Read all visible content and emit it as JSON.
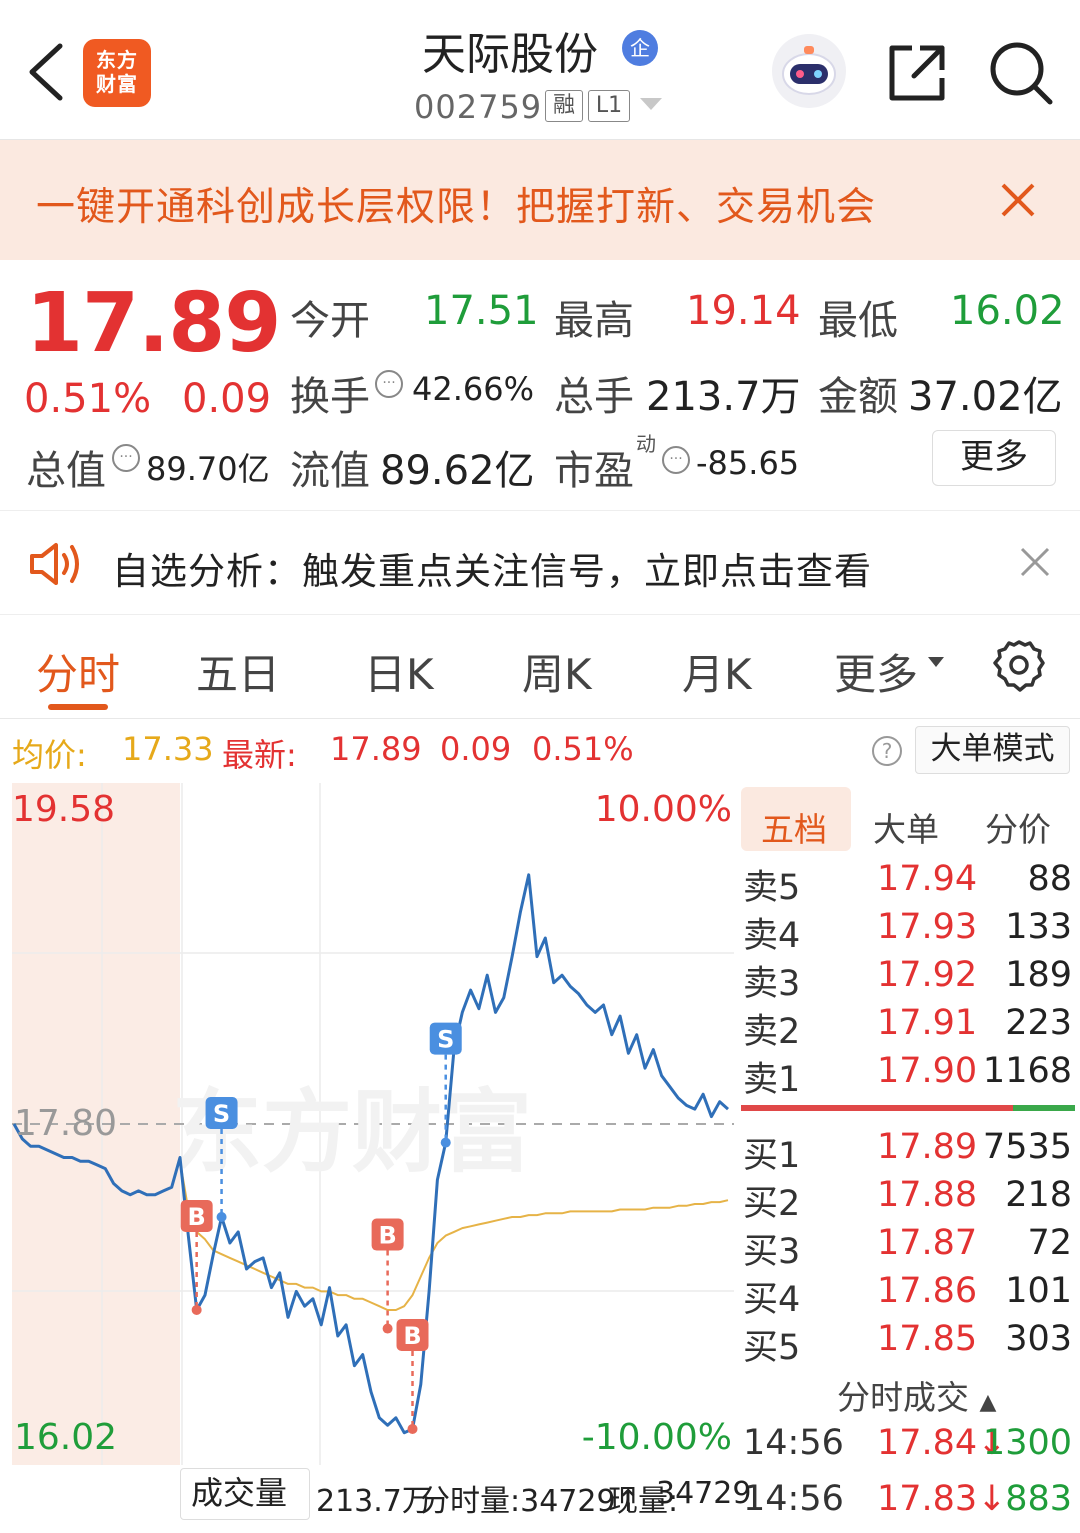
{
  "header": {
    "logo_text_1": "东方",
    "logo_text_2": "财富",
    "stock_name": "天际股份",
    "enterprise_badge": "企",
    "stock_code": "002759",
    "margin_tag": "融",
    "level_tag": "L1"
  },
  "promo": {
    "text": "一键开通科创成长层权限！把握打新、交易机会"
  },
  "quote": {
    "price": "17.89",
    "change_pct": "0.51%",
    "change_amt": "0.09",
    "open_label": "今开",
    "open_value": "17.51",
    "high_label": "最高",
    "high_value": "19.14",
    "low_label": "最低",
    "low_value": "16.02",
    "turnover_label": "换手",
    "turnover_value": "42.66%",
    "volume_label": "总手",
    "volume_value": "213.7万",
    "amount_label": "金额",
    "amount_value": "37.02亿",
    "mktcap_label": "总值",
    "mktcap_value": "89.70亿",
    "float_label": "流值",
    "float_value": "89.62亿",
    "pe_label": "市盈",
    "pe_sup": "动",
    "pe_value": "-85.65",
    "more_button": "更多"
  },
  "notice": {
    "text": "自选分析：触发重点关注信号，立即点击查看"
  },
  "tabs": [
    "分时",
    "五日",
    "日K",
    "周K",
    "月K",
    "更多"
  ],
  "avg_row": {
    "avg_label": "均价:",
    "avg_value": "17.33",
    "last_label": "最新:",
    "last_value": "17.89",
    "chg_amt": "0.09",
    "chg_pct": "0.51%",
    "help": "?",
    "big_order_mode": "大单模式"
  },
  "chart_data": {
    "type": "line",
    "ylim": [
      16.02,
      19.58
    ],
    "y_top_label": "19.58",
    "y_mid_label": "17.80",
    "y_bottom_label": "16.02",
    "pct_top_label": "10.00%",
    "pct_bottom_label": "-10.00%",
    "watermark": "东方财富",
    "series": [
      {
        "values": [
          17.8,
          17.72,
          17.68,
          17.68,
          17.66,
          17.64,
          17.62,
          17.62,
          17.6,
          17.6,
          17.58,
          17.56,
          17.48,
          17.44,
          17.42,
          17.44,
          17.42,
          17.42,
          17.44,
          17.46,
          17.62,
          17.2,
          16.8,
          16.88,
          17.1,
          17.3,
          17.16,
          17.22,
          17.02,
          17.06,
          17.08,
          16.92,
          17.0,
          16.76,
          16.9,
          16.82,
          16.86,
          16.72,
          16.92,
          16.66,
          16.72,
          16.5,
          16.56,
          16.36,
          16.22,
          16.18,
          16.22,
          16.14,
          16.16,
          16.4,
          16.9,
          17.5,
          17.7,
          18.2,
          18.4,
          18.52,
          18.42,
          18.6,
          18.4,
          18.48,
          18.7,
          18.94,
          19.14,
          18.7,
          18.8,
          18.56,
          18.6,
          18.54,
          18.5,
          18.44,
          18.4,
          18.44,
          18.28,
          18.38,
          18.18,
          18.28,
          18.1,
          18.2,
          18.06,
          18.0,
          17.94,
          17.9,
          17.88,
          17.96,
          17.84,
          17.92,
          17.88
        ]
      },
      {
        "values": [
          null,
          null,
          null,
          null,
          null,
          null,
          null,
          null,
          null,
          null,
          null,
          null,
          null,
          null,
          null,
          null,
          null,
          null,
          null,
          null,
          17.6,
          17.34,
          17.22,
          17.18,
          17.12,
          17.1,
          17.08,
          17.06,
          17.04,
          17.02,
          17.0,
          16.98,
          16.96,
          16.94,
          16.94,
          16.92,
          16.92,
          16.9,
          16.9,
          16.88,
          16.88,
          16.86,
          16.86,
          16.84,
          16.82,
          16.8,
          16.8,
          16.82,
          16.88,
          16.98,
          17.08,
          17.16,
          17.2,
          17.22,
          17.24,
          17.25,
          17.26,
          17.27,
          17.28,
          17.29,
          17.3,
          17.3,
          17.31,
          17.31,
          17.32,
          17.32,
          17.32,
          17.33,
          17.33,
          17.33,
          17.33,
          17.33,
          17.33,
          17.34,
          17.34,
          17.34,
          17.34,
          17.35,
          17.35,
          17.35,
          17.36,
          17.36,
          17.37,
          17.37,
          17.38,
          17.38,
          17.39
        ]
      }
    ],
    "markers": [
      {
        "label": "B",
        "index": 22,
        "value": 16.8
      },
      {
        "label": "S",
        "index": 25,
        "value": 17.3
      },
      {
        "label": "B",
        "index": 45,
        "value": 16.7
      },
      {
        "label": "B",
        "index": 48,
        "value": 16.16
      },
      {
        "label": "S",
        "index": 52,
        "value": 17.7
      }
    ]
  },
  "order_book": {
    "tabs": [
      "五档",
      "大单",
      "分价"
    ],
    "sells": [
      {
        "name": "卖5",
        "price": "17.94",
        "vol": "88"
      },
      {
        "name": "卖4",
        "price": "17.93",
        "vol": "133"
      },
      {
        "name": "卖3",
        "price": "17.92",
        "vol": "189"
      },
      {
        "name": "卖2",
        "price": "17.91",
        "vol": "223"
      },
      {
        "name": "卖1",
        "price": "17.90",
        "vol": "1168"
      }
    ],
    "buys": [
      {
        "name": "买1",
        "price": "17.89",
        "vol": "7535"
      },
      {
        "name": "买2",
        "price": "17.88",
        "vol": "218"
      },
      {
        "name": "买3",
        "price": "17.87",
        "vol": "72"
      },
      {
        "name": "买4",
        "price": "17.86",
        "vol": "101"
      },
      {
        "name": "买5",
        "price": "17.85",
        "vol": "303"
      }
    ],
    "ticks_header": "分时成交",
    "ticks": [
      {
        "time": "14:56",
        "price": "17.84",
        "arrow": "↓",
        "vol": "1300"
      },
      {
        "time": "14:56",
        "price": "17.83",
        "arrow": "↓",
        "vol": "883"
      }
    ]
  },
  "volume_bar": {
    "dropdown": "成交量",
    "total": "213.7万",
    "minute_vol": "分时量:34729↑",
    "current_label": "现量:",
    "current_value": "34729"
  },
  "colors": {
    "accent": "#e2581c",
    "up": "#e33232",
    "down": "#1f9d3a",
    "price_line": "#2f6fb8",
    "avg_line": "#e6b347"
  }
}
